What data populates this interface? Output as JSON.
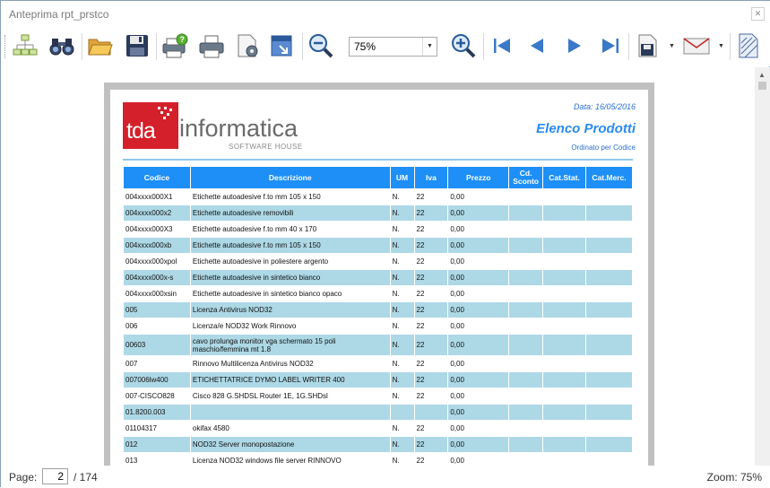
{
  "window": {
    "title": "Anteprima rpt_prstco"
  },
  "toolbar": {
    "zoom_value": "75%",
    "icons": [
      "document-map-icon",
      "search-binoculars-icon",
      "open-folder-icon",
      "save-floppy-icon",
      "print-help-icon",
      "print-icon",
      "page-setup-icon",
      "export-icon",
      "zoom-out-icon",
      "zoom-in-icon",
      "first-page-icon",
      "previous-page-icon",
      "next-page-icon",
      "last-page-icon",
      "save-disk-icon",
      "email-icon",
      "watermark-icon"
    ]
  },
  "report": {
    "logo_brand": "tda",
    "logo_word": "informatica",
    "logo_sub": "SOFTWARE HOUSE",
    "date": "Data: 16/05/2016",
    "title": "Elenco Prodotti",
    "subtitle": "Ordinato per Codice",
    "headers": [
      "Codice",
      "Descrizione",
      "UM",
      "Iva",
      "Prezzo",
      "Cd. Sconto",
      "Cat.Stat.",
      "Cat.Merc."
    ],
    "rows": [
      {
        "code": "004xxxx000X1",
        "desc": "Etichette autoadesive f.to mm  105 x 150",
        "um": "N.",
        "iva": "22",
        "price": "0,00"
      },
      {
        "code": "004xxxx000x2",
        "desc": "Etichette autoadesive removibili",
        "um": "N.",
        "iva": "22",
        "price": "0,00"
      },
      {
        "code": "004xxxx000X3",
        "desc": "Etichette autoadesive f.to mm 40 x 170",
        "um": "N.",
        "iva": "22",
        "price": "0,00"
      },
      {
        "code": "004xxxx000xb",
        "desc": "Etichette autoadesive f.to mm 105 x 150",
        "um": "N.",
        "iva": "22",
        "price": "0,00"
      },
      {
        "code": "004xxxx000xpol",
        "desc": "Etichette autoadesive in poliestere argento",
        "um": "N.",
        "iva": "22",
        "price": "0,00"
      },
      {
        "code": "004xxxx000x-s",
        "desc": "Etichette autoadesive in sintetico bianco",
        "um": "N.",
        "iva": "22",
        "price": "0,00"
      },
      {
        "code": "004xxxx000xsin",
        "desc": "Etichette autoadesive in sintetico bianco opaco",
        "um": "N.",
        "iva": "22",
        "price": "0,00"
      },
      {
        "code": "005",
        "desc": "Licenza Antivirus NOD32",
        "um": "N.",
        "iva": "22",
        "price": "0,00"
      },
      {
        "code": "006",
        "desc": "Licenza/e NOD32 Work Rinnovo",
        "um": "N.",
        "iva": "22",
        "price": "0,00"
      },
      {
        "code": "00603",
        "desc": "cavo prolunga monitor vga schermato 15 poli maschio/femmina mt 1.8",
        "um": "N.",
        "iva": "22",
        "price": "0,00"
      },
      {
        "code": "007",
        "desc": "Rinnovo Multilicenza Antivirus NOD32",
        "um": "N.",
        "iva": "22",
        "price": "0,00"
      },
      {
        "code": "007006lw400",
        "desc": "ETICHETTATRICE DYMO LABEL WRITER 400",
        "um": "N.",
        "iva": "22",
        "price": "0,00"
      },
      {
        "code": "007-CISCO828",
        "desc": "Cisco 828 G.SHDSL Router 1E, 1G.SHDsl",
        "um": "N.",
        "iva": "22",
        "price": "0,00"
      },
      {
        "code": "01.8200.003",
        "desc": "",
        "um": "",
        "iva": "",
        "price": "0,00"
      },
      {
        "code": "01104317",
        "desc": "okifax 4580",
        "um": "N.",
        "iva": "22",
        "price": "0,00"
      },
      {
        "code": "012",
        "desc": "NOD32 Server monopostazione",
        "um": "N.",
        "iva": "22",
        "price": "0,00"
      },
      {
        "code": "013",
        "desc": "Licenza NOD32 windows file server RINNOVO",
        "um": "N.",
        "iva": "22",
        "price": "0,00"
      }
    ]
  },
  "status": {
    "page_label": "Page:",
    "page_current": "2",
    "page_total": "/ 174",
    "zoom": "Zoom: 75%"
  }
}
